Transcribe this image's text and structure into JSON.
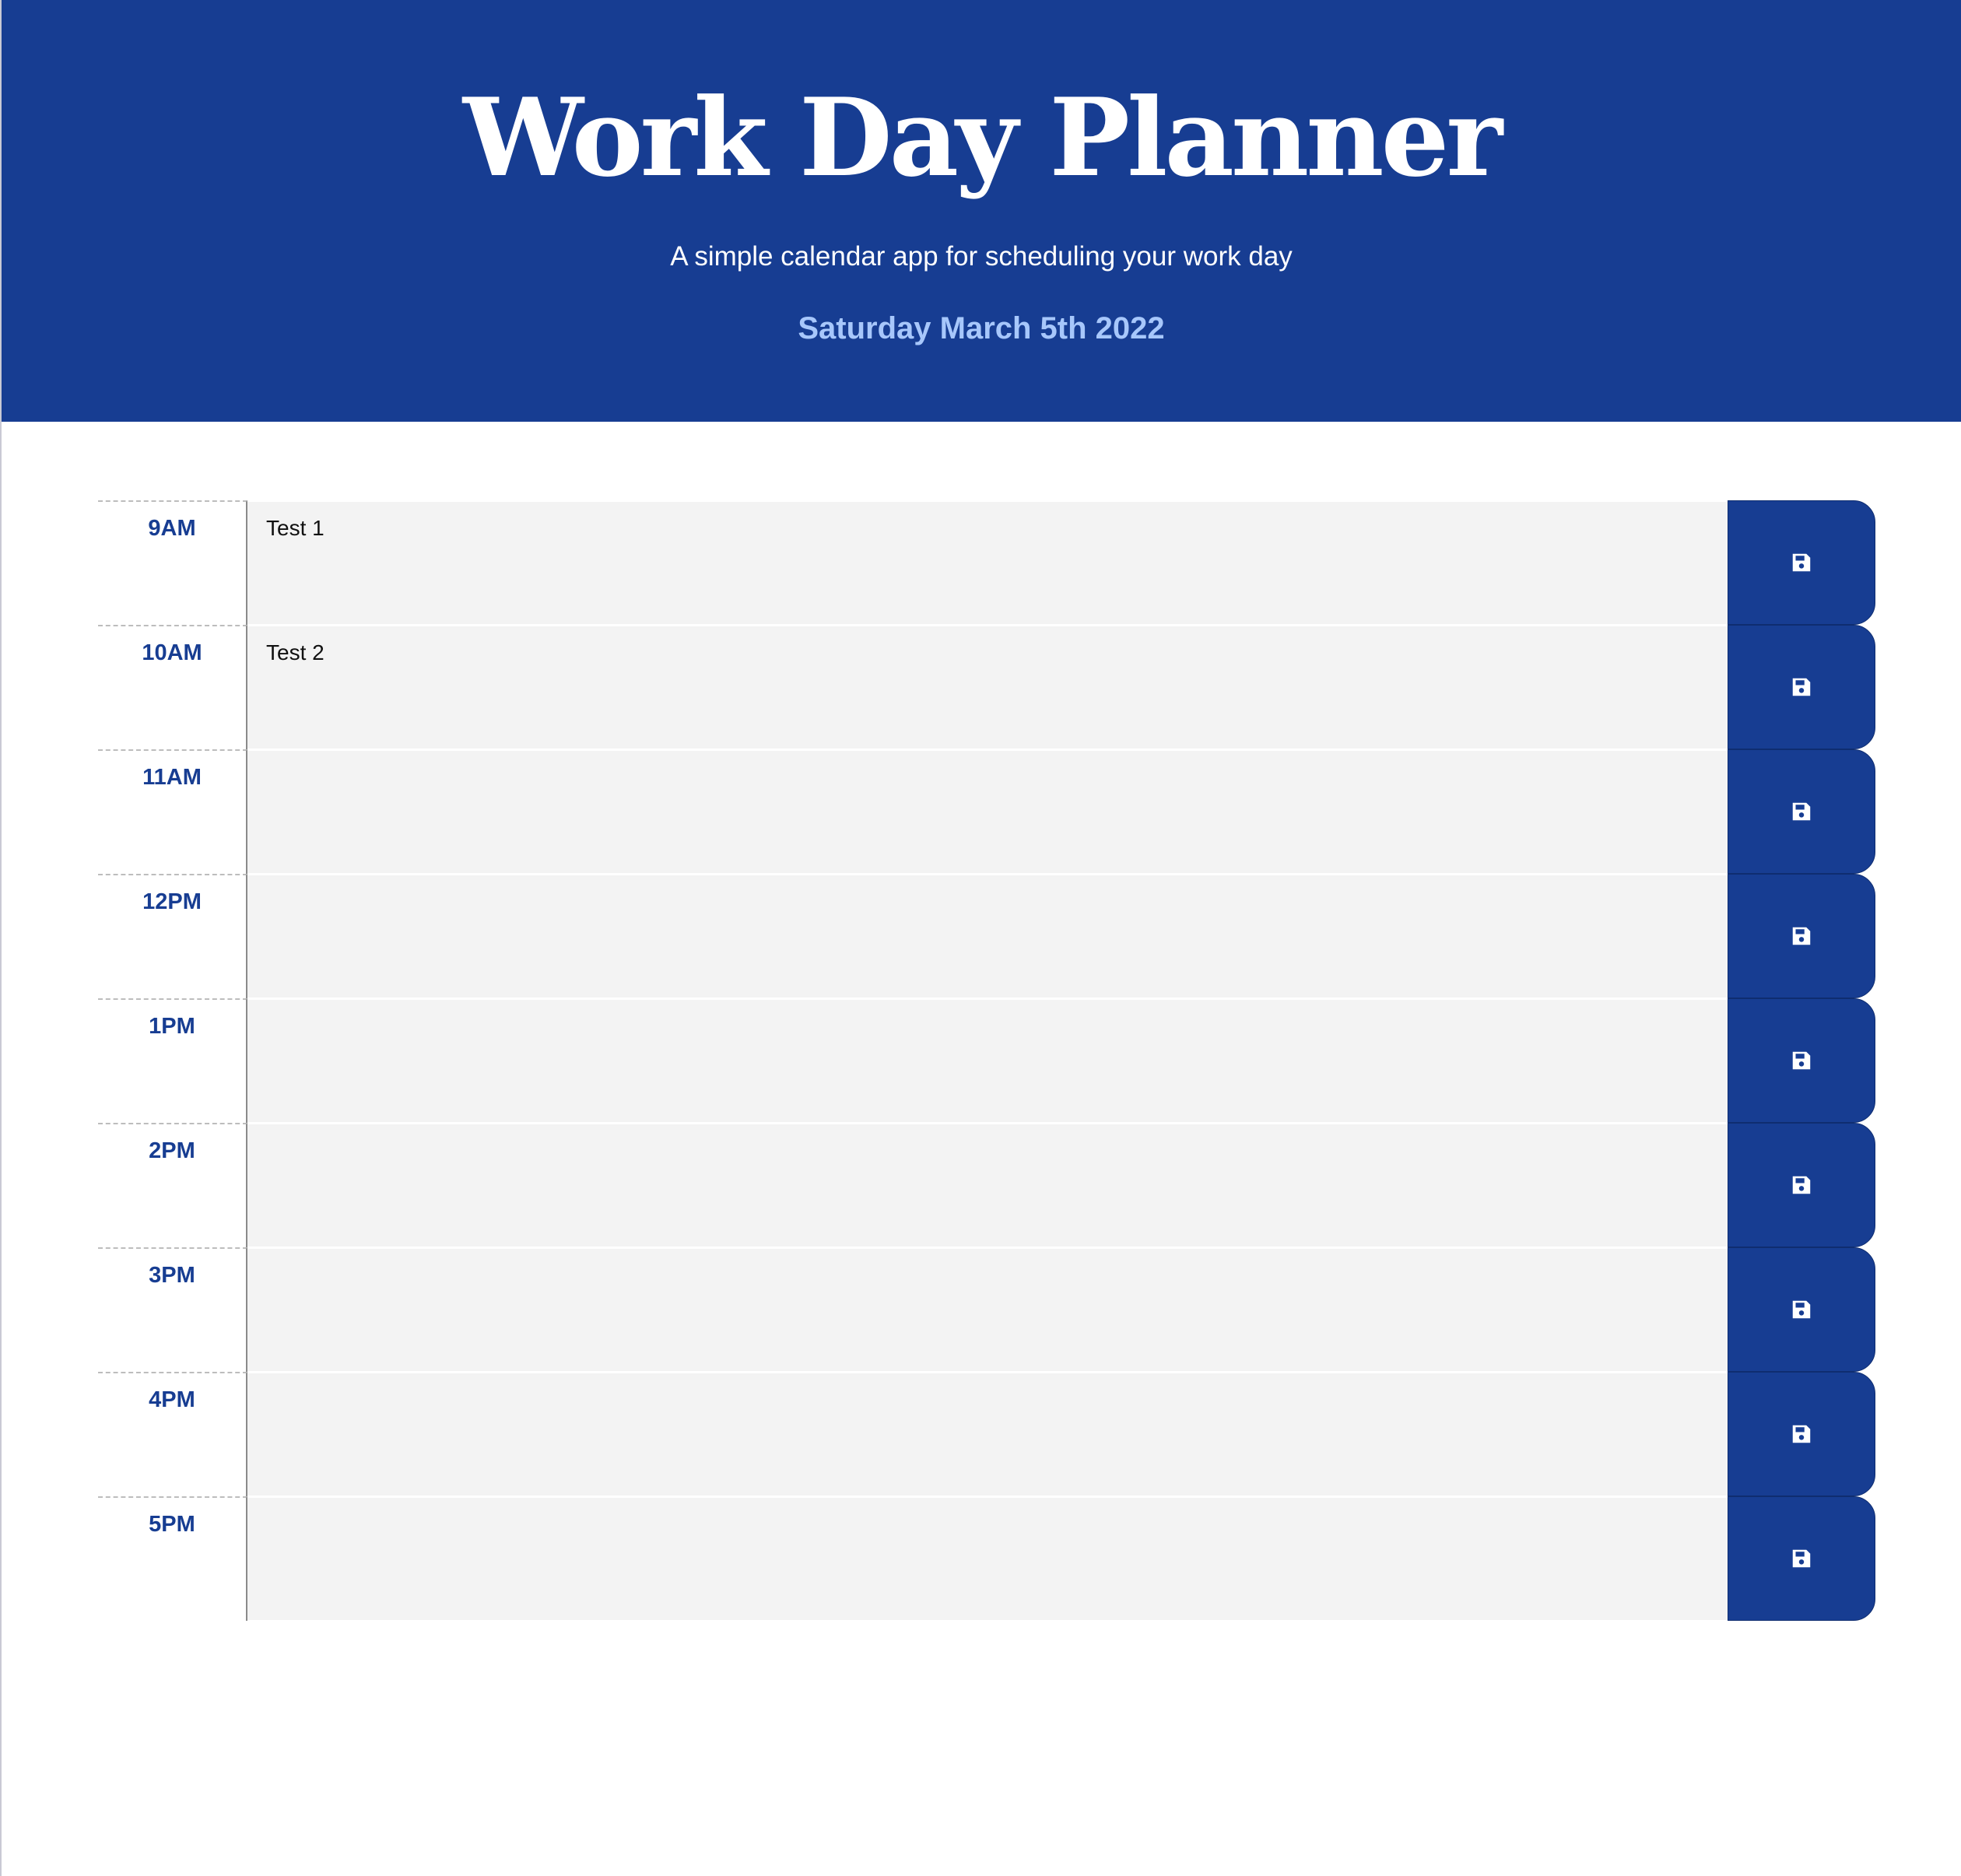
{
  "header": {
    "title": "Work Day Planner",
    "lead": "A simple calendar app for scheduling your work day",
    "current_day": "Saturday March 5th 2022"
  },
  "colors": {
    "brand": "#173d92",
    "date_text": "#a7c7fb",
    "row_background": "#f3f3f3"
  },
  "icons": {
    "save": "floppy-disk-icon"
  },
  "time_blocks": [
    {
      "hour": "9AM",
      "description": "Test 1"
    },
    {
      "hour": "10AM",
      "description": "Test 2"
    },
    {
      "hour": "11AM",
      "description": ""
    },
    {
      "hour": "12PM",
      "description": ""
    },
    {
      "hour": "1PM",
      "description": ""
    },
    {
      "hour": "2PM",
      "description": ""
    },
    {
      "hour": "3PM",
      "description": ""
    },
    {
      "hour": "4PM",
      "description": ""
    },
    {
      "hour": "5PM",
      "description": ""
    }
  ]
}
